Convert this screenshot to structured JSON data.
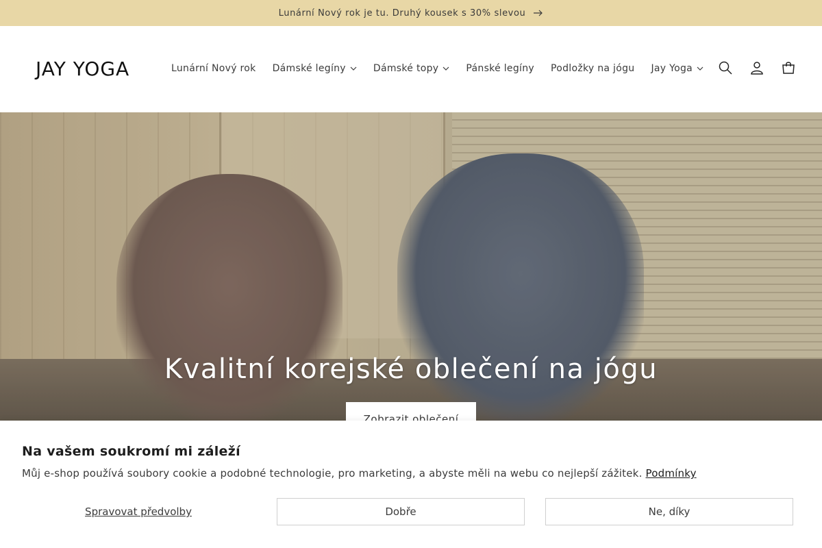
{
  "announcement": {
    "text": "Lunární Nový rok je tu. Druhý kousek s 30% slevou"
  },
  "header": {
    "logo": "JAY YOGA",
    "nav": [
      {
        "label": "Lunární Nový rok",
        "has_dropdown": false
      },
      {
        "label": "Dámské legíny",
        "has_dropdown": true
      },
      {
        "label": "Dámské topy",
        "has_dropdown": true
      },
      {
        "label": "Pánské legíny",
        "has_dropdown": false
      },
      {
        "label": "Podložky na jógu",
        "has_dropdown": false
      },
      {
        "label": "Jay Yoga",
        "has_dropdown": true
      }
    ],
    "icons": [
      "search-icon",
      "account-icon",
      "cart-icon"
    ]
  },
  "hero": {
    "title": "Kvalitní korejské oblečení na jógu",
    "button_label": "Zobrazit oblečení"
  },
  "cookie": {
    "title": "Na vašem soukromí mi záleží",
    "text": "Můj e-shop používá soubory cookie a podobné technologie, pro marketing, a abyste měli na webu co nejlepší zážitek.",
    "terms_link": "Podmínky",
    "manage_label": "Spravovat předvolby",
    "accept_label": "Dobře",
    "decline_label": "Ne, díky"
  },
  "colors": {
    "announcement_bg": "#e8d7a6",
    "text": "#3b3b3b",
    "button_border": "#cfcfcf"
  }
}
